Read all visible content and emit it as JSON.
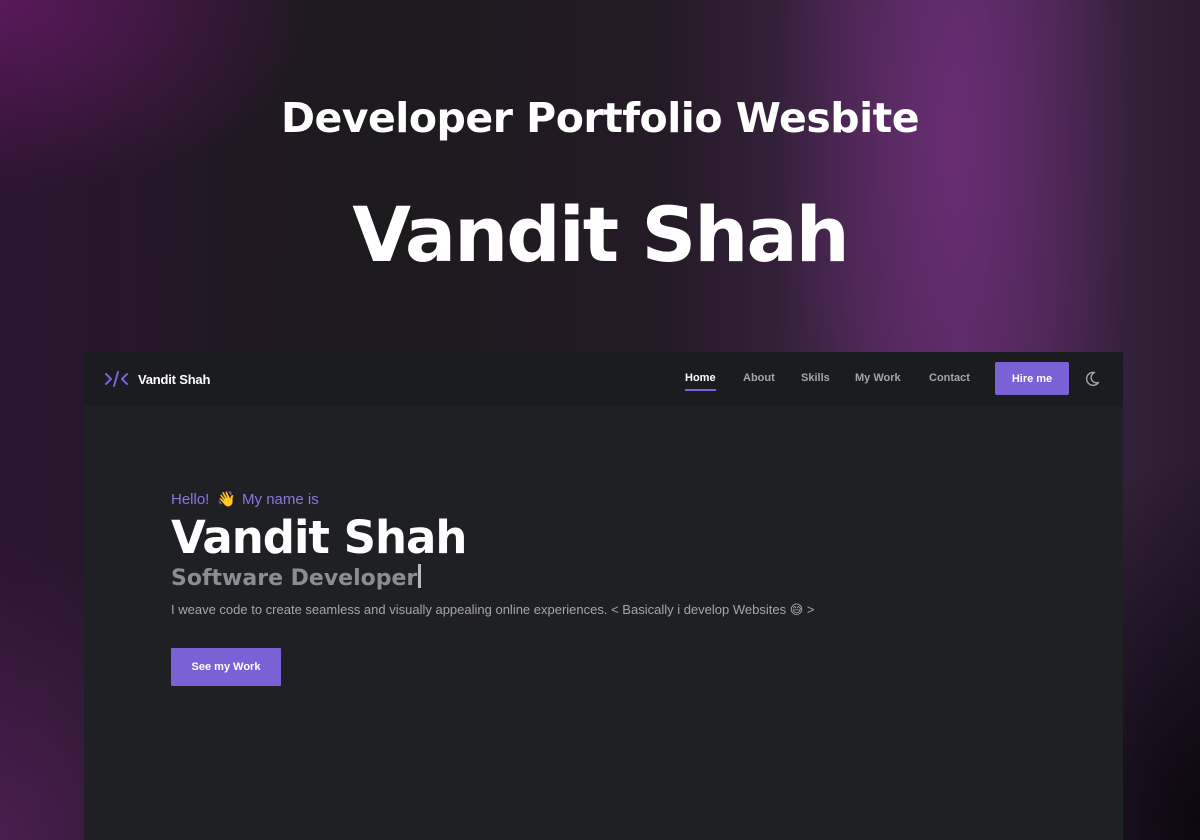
{
  "banner": {
    "title": "Developer Portfolio Wesbite",
    "name": "Vandit Shah"
  },
  "navbar": {
    "brand_icon": "code-brackets-icon",
    "brand_name": "Vandit Shah",
    "links": [
      {
        "label": "Home",
        "active": true
      },
      {
        "label": "About",
        "active": false
      },
      {
        "label": "Skills",
        "active": false
      },
      {
        "label": "My Work",
        "active": false
      },
      {
        "label": "Contact",
        "active": false
      }
    ],
    "hire_label": "Hire me",
    "theme_icon": "moon-icon"
  },
  "intro": {
    "greeting_hello": "Hello!",
    "greeting_emoji": "👋",
    "greeting_rest": "My name is",
    "name": "Vandit Shah",
    "role": "Software Developer",
    "description": "I weave code to create seamless and visually appealing online experiences. < Basically i develop Websites 😅 >",
    "cta_label": "See my Work"
  },
  "colors": {
    "accent": "#7a61d6",
    "window_bg": "#1f2024",
    "greeting": "#8a76e0"
  }
}
